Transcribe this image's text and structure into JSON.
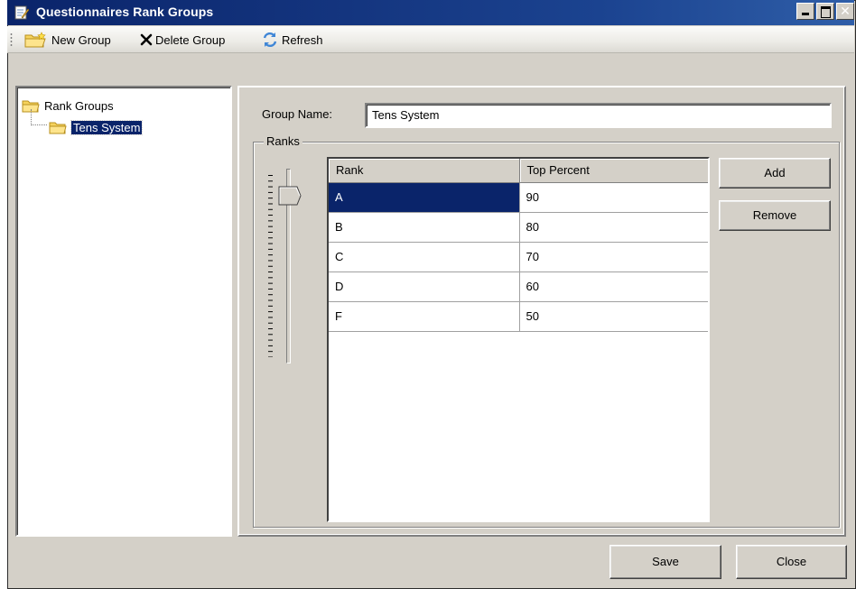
{
  "window": {
    "title": "Questionnaires Rank Groups",
    "controls": {
      "minimize": "minimize-icon",
      "maximize": "maximize-icon",
      "close": "close-icon"
    }
  },
  "toolbar": {
    "new_group": "New Group",
    "delete_group": "Delete Group",
    "refresh": "Refresh"
  },
  "tree": {
    "root_label": "Rank Groups",
    "child_label": "Tens System",
    "selected": "Tens System"
  },
  "details": {
    "group_name_label": "Group Name:",
    "group_name_value": "Tens System",
    "ranks_legend": "Ranks"
  },
  "grid": {
    "columns": [
      "Rank",
      "Top Percent"
    ],
    "rows": [
      {
        "rank": "A",
        "top_percent": "90"
      },
      {
        "rank": "B",
        "top_percent": "80"
      },
      {
        "rank": "C",
        "top_percent": "70"
      },
      {
        "rank": "D",
        "top_percent": "60"
      },
      {
        "rank": "F",
        "top_percent": "50"
      }
    ],
    "selected_row": 0
  },
  "side_buttons": {
    "add": "Add",
    "remove": "Remove"
  },
  "footer": {
    "save": "Save",
    "close": "Close"
  },
  "colors": {
    "title_bar": "#0a246a",
    "selection": "#0a246a",
    "face": "#d4d0c8"
  }
}
